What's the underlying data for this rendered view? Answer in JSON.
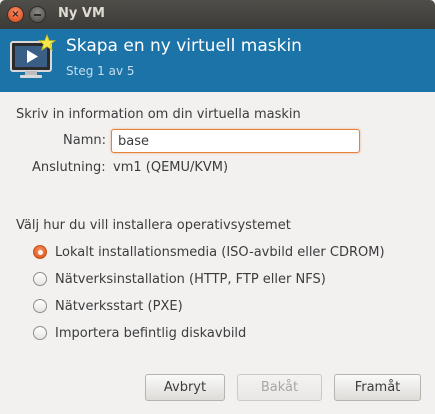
{
  "window": {
    "title": "Ny VM",
    "close_glyph": "×"
  },
  "header": {
    "title": "Skapa en ny virtuell maskin",
    "step": "Steg 1 av 5",
    "icon": "new-vm-monitor-icon",
    "background_color": "#1c73a8"
  },
  "vm_info": {
    "heading": "Skriv in information om din virtuella maskin",
    "name_label": "Namn:",
    "name_value": "base",
    "connection_label": "Anslutning:",
    "connection_value": "vm1 (QEMU/KVM)"
  },
  "install": {
    "heading": "Välj hur du vill installera operativsystemet",
    "options": [
      {
        "label": "Lokalt installationsmedia (ISO-avbild eller CDROM)",
        "selected": true
      },
      {
        "label": "Nätverksinstallation (HTTP, FTP eller NFS)",
        "selected": false
      },
      {
        "label": "Nätverksstart (PXE)",
        "selected": false
      },
      {
        "label": "Importera befintlig diskavbild",
        "selected": false
      }
    ]
  },
  "buttons": {
    "cancel": "Avbryt",
    "back": "Bakåt",
    "back_enabled": false,
    "forward": "Framåt"
  },
  "colors": {
    "accent": "#e05a20",
    "focus_border": "#e7813a"
  }
}
